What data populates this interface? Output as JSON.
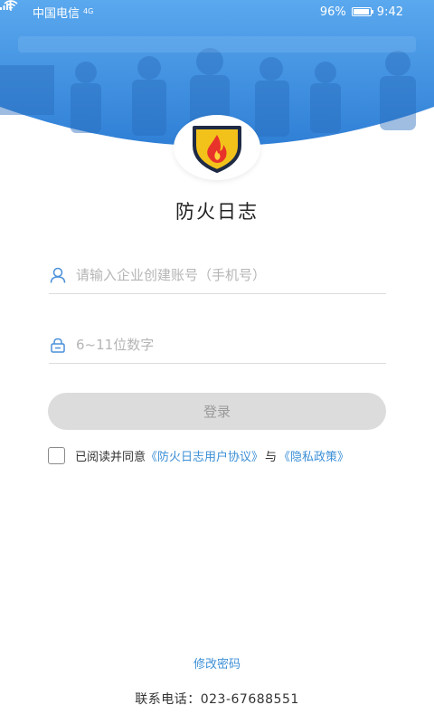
{
  "status_bar": {
    "carrier": "中国电信",
    "network": "4G",
    "battery": "96%",
    "battery_level": 0.96,
    "time": "9:42"
  },
  "app": {
    "title": "防火日志"
  },
  "form": {
    "account_placeholder": "请输入企业创建账号（手机号）",
    "password_placeholder": "6~11位数字",
    "login_label": "登录"
  },
  "agreement": {
    "prefix": "已阅读并同意",
    "user_agreement": "《防火日志用户协议》",
    "conjunction": "与",
    "privacy_policy": "《隐私政策》"
  },
  "footer": {
    "change_password": "修改密码",
    "contact": "联系电话：023-67688551"
  },
  "colors": {
    "header_blue": "#3a8ee0",
    "link_blue": "#3c8fd6",
    "button_disabled": "#dcdcdc",
    "shield_yellow": "#f2c21b",
    "flame_red": "#e8332a"
  }
}
